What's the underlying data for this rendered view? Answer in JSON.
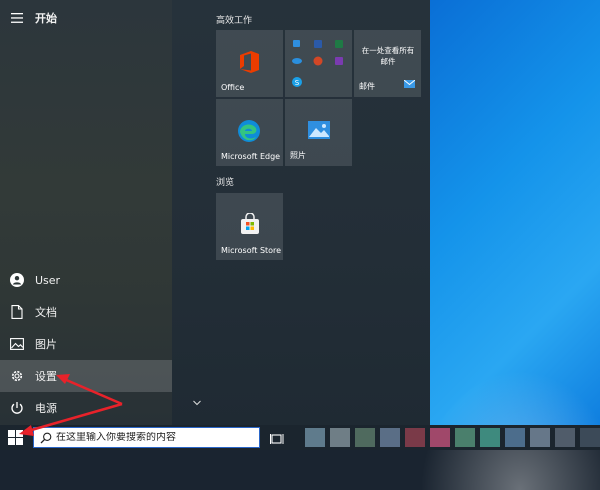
{
  "start_menu": {
    "title": "开始",
    "rail": [
      {
        "label": "User",
        "icon": "user-avatar-icon"
      },
      {
        "label": "文档",
        "icon": "document-icon"
      },
      {
        "label": "图片",
        "icon": "picture-icon"
      },
      {
        "label": "设置",
        "icon": "gear-icon"
      },
      {
        "label": "电源",
        "icon": "power-icon"
      }
    ],
    "groups": [
      {
        "label": "高效工作"
      },
      {
        "label": "浏览"
      }
    ],
    "tiles": {
      "office": "Office",
      "mail_text": "在一处查看所有邮件",
      "mail": "邮件",
      "edge": "Microsoft Edge",
      "photos": "照片",
      "store": "Microsoft Store"
    }
  },
  "taskbar": {
    "search_placeholder": "在这里输入你要搜索的内容"
  },
  "colors": {
    "arrow": "#e8222a",
    "desktop": "#1493ea",
    "active_item": "#4a5250"
  }
}
